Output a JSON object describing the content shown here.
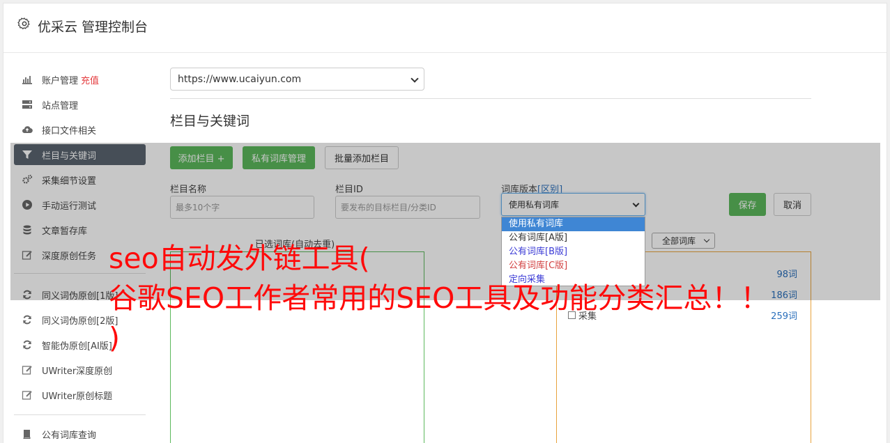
{
  "app": {
    "title": "优采云 管理控制台"
  },
  "sidebar": {
    "items": [
      {
        "label": "账户管理",
        "extra": "充值",
        "icon": "bar-chart-icon"
      },
      {
        "label": "站点管理",
        "icon": "server-icon"
      },
      {
        "label": "接口文件相关",
        "icon": "cloud-upload-icon"
      },
      {
        "label": "栏目与关键词",
        "icon": "filter-icon",
        "active": true
      },
      {
        "label": "采集细节设置",
        "icon": "cogs-icon"
      },
      {
        "label": "手动运行测试",
        "icon": "play-circle-icon"
      },
      {
        "label": "文章暂存库",
        "icon": "database-icon"
      },
      {
        "label": "深度原创任务",
        "icon": "edit-icon"
      },
      {
        "label": "同义词伪原创[1版]",
        "icon": "refresh-icon"
      },
      {
        "label": "同义词伪原创[2版]",
        "icon": "refresh-icon"
      },
      {
        "label": "智能伪原创[AI版]",
        "icon": "refresh-icon"
      },
      {
        "label": "UWriter深度原创",
        "icon": "edit-icon"
      },
      {
        "label": "UWriter原创标题",
        "icon": "edit-icon"
      },
      {
        "label": "公有词库查询",
        "icon": "book-icon"
      }
    ]
  },
  "main": {
    "site_select": {
      "value": "https://www.ucaiyun.com"
    },
    "section_title": "栏目与关键词",
    "buttons": {
      "add_column": "添加栏目 +",
      "private_lexicon": "私有词库管理",
      "batch_add": "批量添加栏目",
      "save": "保存",
      "cancel": "取消"
    },
    "form": {
      "name_label": "栏目名称",
      "name_placeholder": "最多10个字",
      "id_label": "栏目ID",
      "id_placeholder": "要发布的目标栏目/分类ID",
      "version_label": "词库版本",
      "version_link": "[区别]",
      "version_value": "使用私有词库"
    },
    "dropdown_options": [
      {
        "label": "使用私有词库",
        "color": "#ffffff",
        "selected": true
      },
      {
        "label": "公有词库[A版]",
        "color": "#333333"
      },
      {
        "label": "公有词库[B版]",
        "color": "#3b3bd6"
      },
      {
        "label": "公有词库[C版]",
        "color": "#d23f3f"
      },
      {
        "label": "定向采集",
        "color": "#3b3bd6"
      }
    ],
    "selected_caption": "已选词库(自动去重)",
    "filter_select": "全部词库",
    "lexicon_rows": [
      {
        "name": "",
        "count": "98词"
      },
      {
        "name": "",
        "count": "186词"
      },
      {
        "name": "采集",
        "count": "259词"
      }
    ]
  },
  "watermark": {
    "line1": "seo自动发外链工具(",
    "line2": "谷歌SEO工作者常用的SEO工具及功能分类汇总！！",
    "line3": ")"
  },
  "colors": {
    "accent_green": "#5cb85c",
    "sidebar_active": "#5a6470",
    "link_blue": "#2a6fbb",
    "watermark_red": "#ff0a0a"
  }
}
